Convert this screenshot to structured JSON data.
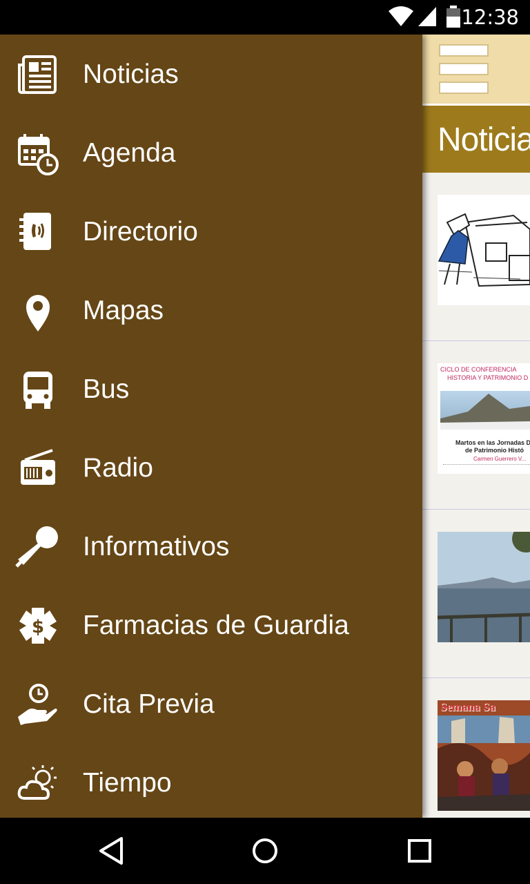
{
  "status_bar": {
    "time": "12:38",
    "icons": [
      "wifi-icon",
      "cell-signal-icon",
      "battery-icon"
    ]
  },
  "toolbar": {
    "menu_icon": "hamburger-icon",
    "background": "#efdca8"
  },
  "section": {
    "title": "Noticias",
    "background": "#9d7a1c"
  },
  "drawer": {
    "background": "#654616",
    "items": [
      {
        "label": "Noticias",
        "icon": "newspaper-icon"
      },
      {
        "label": "Agenda",
        "icon": "calendar-clock-icon"
      },
      {
        "label": "Directorio",
        "icon": "phone-book-icon"
      },
      {
        "label": "Mapas",
        "icon": "map-pin-icon"
      },
      {
        "label": "Bus",
        "icon": "bus-icon"
      },
      {
        "label": "Radio",
        "icon": "radio-icon"
      },
      {
        "label": "Informativos",
        "icon": "microphone-icon"
      },
      {
        "label": "Farmacias de Guardia",
        "icon": "pharmacy-icon"
      },
      {
        "label": "Cita Previa",
        "icon": "appointment-hand-icon"
      },
      {
        "label": "Tiempo",
        "icon": "weather-icon"
      }
    ]
  },
  "news": {
    "items": [
      {
        "thumb": "sketch-illustration"
      },
      {
        "thumb": "conference-poster",
        "poster_line_1": "CICLO DE CONFERENCIA",
        "poster_line_2": "HISTORIA Y PATRIMONIO D",
        "poster_line_3": "Martos en las Jornadas D",
        "poster_line_4": "de Patrimonio Histó",
        "poster_line_5": "Carmen Guerrero V..."
      },
      {
        "thumb": "lake-photo"
      },
      {
        "thumb": "semana-santa-poster",
        "poster_title": "Semana Sa"
      }
    ]
  },
  "nav_bar": {
    "back_icon": "back-icon",
    "home_icon": "home-icon",
    "recents_icon": "recents-icon"
  }
}
